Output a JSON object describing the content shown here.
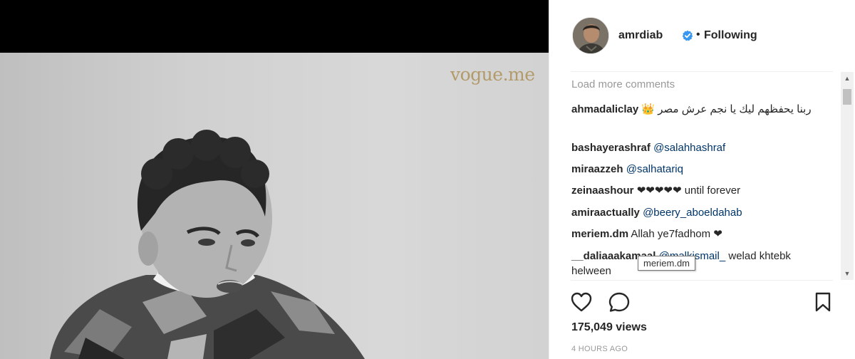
{
  "media": {
    "watermark": "vogue.me"
  },
  "post_header": {
    "username": "amrdiab",
    "separator": "•",
    "follow_status": "Following",
    "verified_icon": "verified-badge-icon",
    "verified_color": "#3897f0"
  },
  "comments": {
    "load_more": "Load more comments",
    "items": [
      {
        "user": "ahmadaliclay",
        "text": "ربنا يحفظهم ليك يا نجم عرش مصر 👑"
      },
      {
        "user": "bashayerashraf",
        "mention": "@salahhashraf"
      },
      {
        "user": "miraazzeh",
        "mention": "@salhatariq"
      },
      {
        "user": "zeinaashour",
        "text": "❤❤❤❤❤ until forever"
      },
      {
        "user": "amiraactually",
        "mention": "@beery_aboeldahab"
      },
      {
        "user": "meriem.dm",
        "text": "Allah ye7fadhom ❤"
      },
      {
        "user": "__daliaaakamaal",
        "mention": "@malkismail_",
        "text": " welad khtebk helween"
      }
    ],
    "tooltip": "meriem.dm"
  },
  "scrollbar": {
    "up_glyph": "▲",
    "down_glyph": "▼"
  },
  "actions": {
    "like_icon": "heart-icon",
    "comment_icon": "comment-icon",
    "save_icon": "bookmark-icon"
  },
  "stats": {
    "views": "175,049 views",
    "timestamp": "4 HOURS AGO"
  },
  "colors": {
    "mention": "#003569",
    "heart": "#e0202e",
    "muted": "#999999",
    "watermark": "#b29a6a"
  }
}
